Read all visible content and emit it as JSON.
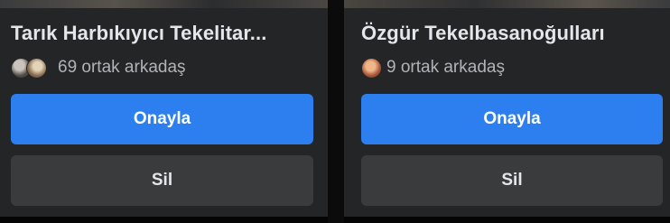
{
  "cards": [
    {
      "name": "Tarık Harbıkıyıcı Tekelitar...",
      "mutual_friends": "69 ortak arkadaş",
      "confirm_label": "Onayla",
      "delete_label": "Sil"
    },
    {
      "name": "Özgür Tekelbasanoğulları",
      "mutual_friends": "9 ortak arkadaş",
      "confirm_label": "Onayla",
      "delete_label": "Sil"
    }
  ],
  "colors": {
    "card_background": "#242526",
    "confirm_button": "#2d7ff0",
    "delete_button": "#3a3b3c",
    "primary_text": "#e4e6eb",
    "secondary_text": "#b0b3b8"
  }
}
